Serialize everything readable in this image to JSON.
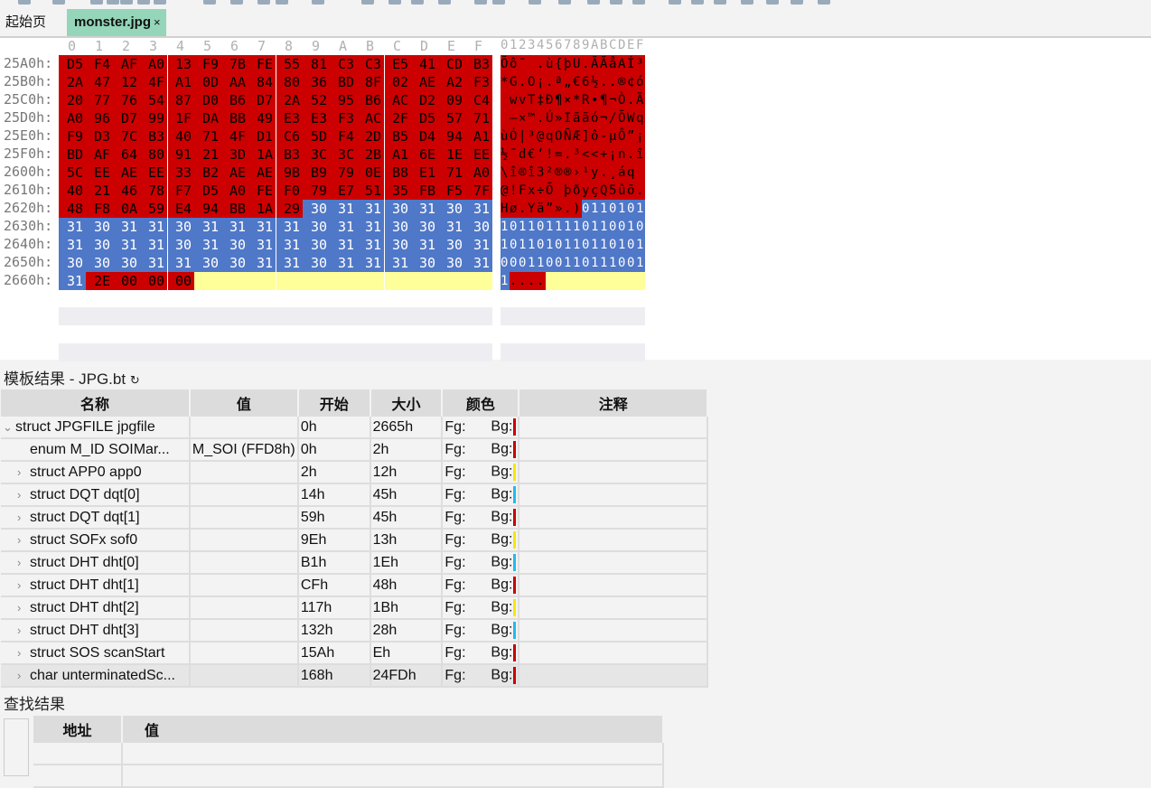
{
  "tabs": [
    {
      "label": "起始页"
    },
    {
      "label": "monster.jpg",
      "close": "×"
    }
  ],
  "hex": {
    "col_header": [
      "0",
      "1",
      "2",
      "3",
      "4",
      "5",
      "6",
      "7",
      "8",
      "9",
      "A",
      "B",
      "C",
      "D",
      "E",
      "F"
    ],
    "ascii_header": "0123456789ABCDEF",
    "rows": [
      {
        "addr": "25A0h:",
        "offset": "25A0",
        "bytes": "D5 F4 AF A0 13 F9 7B FE 55 81 C3 C3 E5 41 CD B3",
        "ascii": "Õô¯ .ù{þU.ÃÃåAÍ³"
      },
      {
        "addr": "25B0h:",
        "offset": "25B0",
        "bytes": "2A 47 12 4F A1 0D AA 84 80 36 BD 8F 02 AE A2 F3",
        "ascii": "*G.O¡.ª„€6½..®¢ó"
      },
      {
        "addr": "25C0h:",
        "offset": "25C0",
        "bytes": "20 77 76 54 87 D0 B6 D7 2A 52 95 B6 AC D2 09 C4",
        "ascii": " wvT‡Ð¶×*R•¶¬Ò.Ä"
      },
      {
        "addr": "25D0h:",
        "offset": "25D0",
        "bytes": "A0 96 D7 99 1F DA BB 49 E3 E3 F3 AC 2F D5 57 71",
        "ascii": " –×™.Ú»Iããó¬/ÕWq"
      },
      {
        "addr": "25E0h:",
        "offset": "25E0",
        "bytes": "F9 D3 7C B3 40 71 4F D1 C6 5D F4 2D B5 D4 94 A1",
        "ascii": "ùÓ|³@qOÑÆ]ô-µÔ”¡"
      },
      {
        "addr": "25F0h:",
        "offset": "25F0",
        "bytes": "BD AF 64 80 91 21 3D 1A B3 3C 3C 2B A1 6E 1E EE",
        "ascii": "½¯d€‘!=.³<<+¡n.î"
      },
      {
        "addr": "2600h:",
        "offset": "2600",
        "bytes": "5C EE AE EE 33 B2 AE AE 9B B9 79 0E B8 E1 71 A0",
        "ascii": "\\î®î3²®®›¹y.¸áq "
      },
      {
        "addr": "2610h:",
        "offset": "2610",
        "bytes": "40 21 46 78 F7 D5 A0 FE F0 79 E7 51 35 FB F5 7F",
        "ascii": "@!Fx÷Õ þðyçQ5ûõ."
      },
      {
        "addr": "2620h:",
        "offset": "2620",
        "bytes": "48 F8 0A 59 E4 94 BB 1A 29 30 31 31 30 31 30 31",
        "ascii": "Hø.Yä”».)0110101"
      },
      {
        "addr": "2630h:",
        "offset": "2630",
        "bytes": "31 30 31 31 30 31 31 31 31 30 31 31 30 30 31 30",
        "ascii": "1011011110110010"
      },
      {
        "addr": "2640h:",
        "offset": "2640",
        "bytes": "31 30 31 31 30 31 30 31 31 30 31 31 30 31 30 31",
        "ascii": "1011010110110101"
      },
      {
        "addr": "2650h:",
        "offset": "2650",
        "bytes": "30 30 30 31 31 30 30 31 31 30 31 31 31 30 30 31",
        "ascii": "0001100110111001"
      },
      {
        "addr": "2660h:",
        "offset": "2660",
        "bytes": "31 2E 00 00 00",
        "ascii": "1...."
      }
    ],
    "highlights": [
      {
        "start": "25A0",
        "end": "2628",
        "bg": "#cc0000",
        "fg": "#000000"
      },
      {
        "start": "2629",
        "end": "2660",
        "bg": "#5078c8",
        "fg": "#ffffff"
      },
      {
        "start": "2661",
        "end": "2664",
        "bg": "#cc0000",
        "fg": "#000000"
      }
    ],
    "empty_bg": "#ffff99"
  },
  "template": {
    "title": "模板结果 - JPG.bt",
    "refresh_icon": "refresh-icon",
    "columns": [
      "名称",
      "值",
      "开始",
      "大小",
      "颜色",
      "注释"
    ],
    "rows": [
      {
        "name": "struct JPGFILE jpgfile",
        "value": "",
        "start": "0h",
        "size": "2665h",
        "fg": "Fg:",
        "bg": "Bg:",
        "bgcolor": "#cc0000",
        "expander": "expanded",
        "indent": 0
      },
      {
        "name": "enum M_ID SOIMar...",
        "value": "M_SOI (FFD8h)",
        "start": "0h",
        "size": "2h",
        "fg": "Fg:",
        "bg": "Bg:",
        "bgcolor": "#cc0000",
        "expander": "none",
        "indent": 1
      },
      {
        "name": "struct APP0 app0",
        "value": "",
        "start": "2h",
        "size": "12h",
        "fg": "Fg:",
        "bg": "Bg:",
        "bgcolor": "#f5e800",
        "expander": "collapsed",
        "indent": 1
      },
      {
        "name": "struct DQT dqt[0]",
        "value": "",
        "start": "14h",
        "size": "45h",
        "fg": "Fg:",
        "bg": "Bg:",
        "bgcolor": "#22bbee",
        "expander": "collapsed",
        "indent": 1
      },
      {
        "name": "struct DQT dqt[1]",
        "value": "",
        "start": "59h",
        "size": "45h",
        "fg": "Fg:",
        "bg": "Bg:",
        "bgcolor": "#cc0000",
        "expander": "collapsed",
        "indent": 1
      },
      {
        "name": "struct SOFx sof0",
        "value": "",
        "start": "9Eh",
        "size": "13h",
        "fg": "Fg:",
        "bg": "Bg:",
        "bgcolor": "#f5e800",
        "expander": "collapsed",
        "indent": 1
      },
      {
        "name": "struct DHT dht[0]",
        "value": "",
        "start": "B1h",
        "size": "1Eh",
        "fg": "Fg:",
        "bg": "Bg:",
        "bgcolor": "#22bbee",
        "expander": "collapsed",
        "indent": 1
      },
      {
        "name": "struct DHT dht[1]",
        "value": "",
        "start": "CFh",
        "size": "48h",
        "fg": "Fg:",
        "bg": "Bg:",
        "bgcolor": "#cc0000",
        "expander": "collapsed",
        "indent": 1
      },
      {
        "name": "struct DHT dht[2]",
        "value": "",
        "start": "117h",
        "size": "1Bh",
        "fg": "Fg:",
        "bg": "Bg:",
        "bgcolor": "#f5e800",
        "expander": "collapsed",
        "indent": 1
      },
      {
        "name": "struct DHT dht[3]",
        "value": "",
        "start": "132h",
        "size": "28h",
        "fg": "Fg:",
        "bg": "Bg:",
        "bgcolor": "#22bbee",
        "expander": "collapsed",
        "indent": 1
      },
      {
        "name": "struct SOS scanStart",
        "value": "",
        "start": "15Ah",
        "size": "Eh",
        "fg": "Fg:",
        "bg": "Bg:",
        "bgcolor": "#cc0000",
        "expander": "collapsed",
        "indent": 1
      },
      {
        "name": "char unterminatedSc...",
        "value": "",
        "start": "168h",
        "size": "24FDh",
        "fg": "Fg:",
        "bg": "Bg:",
        "bgcolor": "#cc0000",
        "expander": "collapsed",
        "indent": 1,
        "selected": true
      }
    ]
  },
  "find": {
    "title": "查找结果",
    "columns": [
      "地址",
      "值"
    ]
  }
}
